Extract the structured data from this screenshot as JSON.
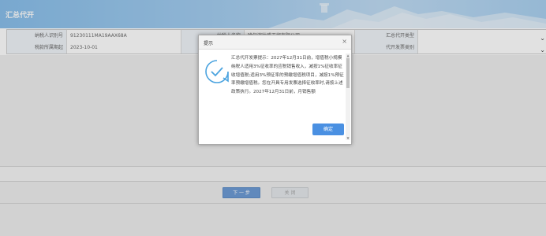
{
  "header": {
    "title": "汇总代开"
  },
  "form": {
    "rows": [
      [
        {
          "label": "纳税人识别号",
          "value": "91230111MA19AAX68A"
        },
        {
          "label": "纳税人名称",
          "value": "哈尔滨壮盛工贸有限公司"
        },
        {
          "label": "汇总代开类型",
          "value": ""
        }
      ],
      [
        {
          "label": "税款所属期起",
          "value": "2023-10-01"
        },
        {
          "label": "",
          "value": ""
        },
        {
          "label": "代开发票类别",
          "value": ""
        }
      ]
    ]
  },
  "buttons": {
    "next": "下 一 步",
    "close": "关 闭"
  },
  "dialog": {
    "title": "提示",
    "close_glyph": "×",
    "message": "汇总代开发票提示：2027年12月31日前，增值税小规模纳税人适用3%征收率的应税销售收入，减按1%征收率征收增值税;适用3%预征率的预缴增值税项目，减按1%预征率预缴增值税。您在开具专用发票选择征收率时,请按上述政策执行。2027年12月31日前，月销售额",
    "ok_label": "确定",
    "check_icon": "check-circle-icon"
  },
  "colors": {
    "header": "#8cc0ec",
    "primary": "#4a90e2"
  }
}
